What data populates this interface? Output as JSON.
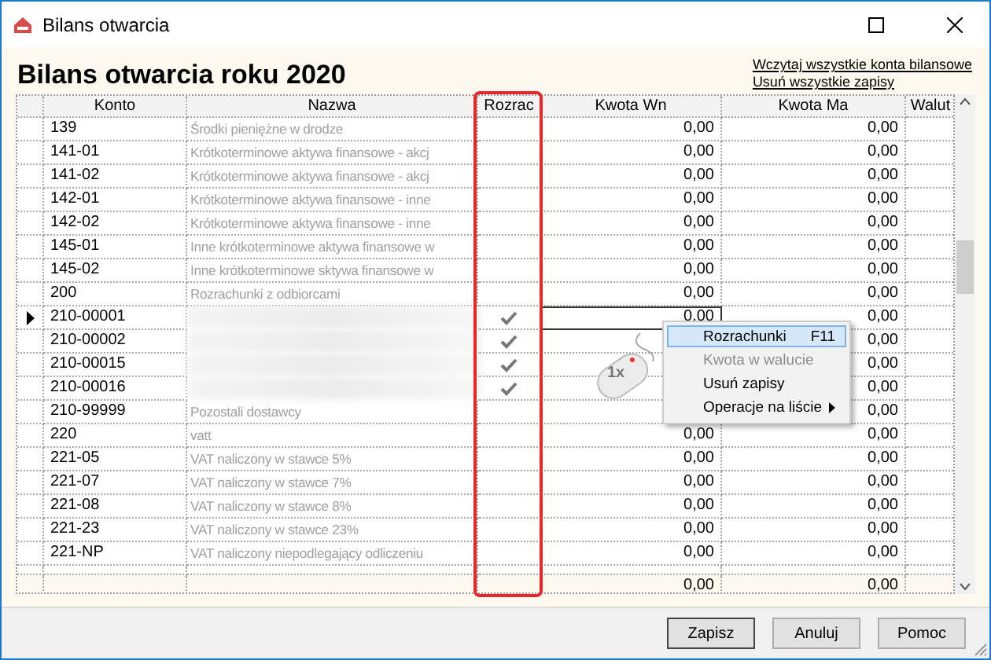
{
  "window": {
    "title": "Bilans otwarcia"
  },
  "heading": "Bilans otwarcia roku 2020",
  "links": [
    "Wczytaj wszystkie konta bilansowe",
    "Usuń wszystkie zapisy"
  ],
  "table": {
    "columns": [
      "Konto",
      "Nazwa",
      "Rozrac",
      "Kwota Wn",
      "Kwota Ma",
      "Walut"
    ],
    "rows": [
      {
        "konto": "139",
        "name": "Środki pieniężne w drodze",
        "settled": false,
        "kwota_wn": "0,00",
        "kwota_ma": "0,00",
        "selected": false
      },
      {
        "konto": "141-01",
        "name": "Krótkoterminowe aktywa finansowe - akcj",
        "settled": false,
        "kwota_wn": "0,00",
        "kwota_ma": "0,00",
        "selected": false
      },
      {
        "konto": "141-02",
        "name": "Krótkoterminowe aktywa finansowe - akcj",
        "settled": false,
        "kwota_wn": "0,00",
        "kwota_ma": "0,00",
        "selected": false
      },
      {
        "konto": "142-01",
        "name": "Krótkoterminowe aktywa finansowe - inne",
        "settled": false,
        "kwota_wn": "0,00",
        "kwota_ma": "0,00",
        "selected": false
      },
      {
        "konto": "142-02",
        "name": "Krótkoterminowe aktywa finansowe - inne",
        "settled": false,
        "kwota_wn": "0,00",
        "kwota_ma": "0,00",
        "selected": false
      },
      {
        "konto": "145-01",
        "name": "Inne krótkoterminowe aktywa finansowe w",
        "settled": false,
        "kwota_wn": "0,00",
        "kwota_ma": "0,00",
        "selected": false
      },
      {
        "konto": "145-02",
        "name": "Inne krótkoterminowe sktywa finansowe w",
        "settled": false,
        "kwota_wn": "0,00",
        "kwota_ma": "0,00",
        "selected": false
      },
      {
        "konto": "200",
        "name": "Rozrachunki z odbiorcami",
        "settled": false,
        "kwota_wn": "0,00",
        "kwota_ma": "0,00",
        "selected": false
      },
      {
        "konto": "210-00001",
        "settled": true,
        "kwota_wn": "0,00",
        "kwota_ma": "0,00",
        "selected": true
      },
      {
        "konto": "210-00002",
        "settled": true,
        "kwota_ma": "0,00",
        "selected": false
      },
      {
        "konto": "210-00015",
        "settled": true,
        "kwota_ma": "0,00",
        "selected": false
      },
      {
        "konto": "210-00016",
        "settled": true,
        "kwota_ma": "0,00",
        "selected": false
      },
      {
        "konto": "210-99999",
        "name": "Pozostali dostawcy",
        "settled": false,
        "kwota_ma": "0,00",
        "selected": false
      },
      {
        "konto": "220",
        "name": "vatt",
        "settled": false,
        "kwota_wn": "0,00",
        "kwota_ma": "0,00",
        "selected": false
      },
      {
        "konto": "221-05",
        "name": "VAT naliczony w stawce 5%",
        "settled": false,
        "kwota_wn": "0,00",
        "kwota_ma": "0,00",
        "selected": false
      },
      {
        "konto": "221-07",
        "name": "VAT naliczony w stawce 7%",
        "settled": false,
        "kwota_wn": "0,00",
        "kwota_ma": "0,00",
        "selected": false
      },
      {
        "konto": "221-08",
        "name": "VAT naliczony w stawce 8%",
        "settled": false,
        "kwota_wn": "0,00",
        "kwota_ma": "0,00",
        "selected": false
      },
      {
        "konto": "221-23",
        "name": "VAT naliczony w stawce 23%",
        "settled": false,
        "kwota_wn": "0,00",
        "kwota_ma": "0,00",
        "selected": false
      },
      {
        "konto": "221-NP",
        "name": "VAT naliczony niepodlegający odliczeniu",
        "settled": false,
        "kwota_wn": "0,00",
        "kwota_ma": "0,00",
        "selected": false
      }
    ],
    "totals": {
      "kwota_wn": "0,00",
      "kwota_ma": "0,00"
    }
  },
  "context_menu": {
    "items": [
      {
        "label": "Rozrachunki",
        "shortcut": "F11",
        "selected": true,
        "disabled": false,
        "submenu": false
      },
      {
        "label": "Kwota w walucie",
        "selected": false,
        "disabled": true,
        "submenu": false
      },
      {
        "label": "Usuń zapisy",
        "selected": false,
        "disabled": false,
        "submenu": false
      },
      {
        "label": "Operacje na liście",
        "selected": false,
        "disabled": false,
        "submenu": true
      }
    ]
  },
  "mouse_hint": "1x",
  "buttons": [
    "Zapisz",
    "Anuluj",
    "Pomoc"
  ]
}
